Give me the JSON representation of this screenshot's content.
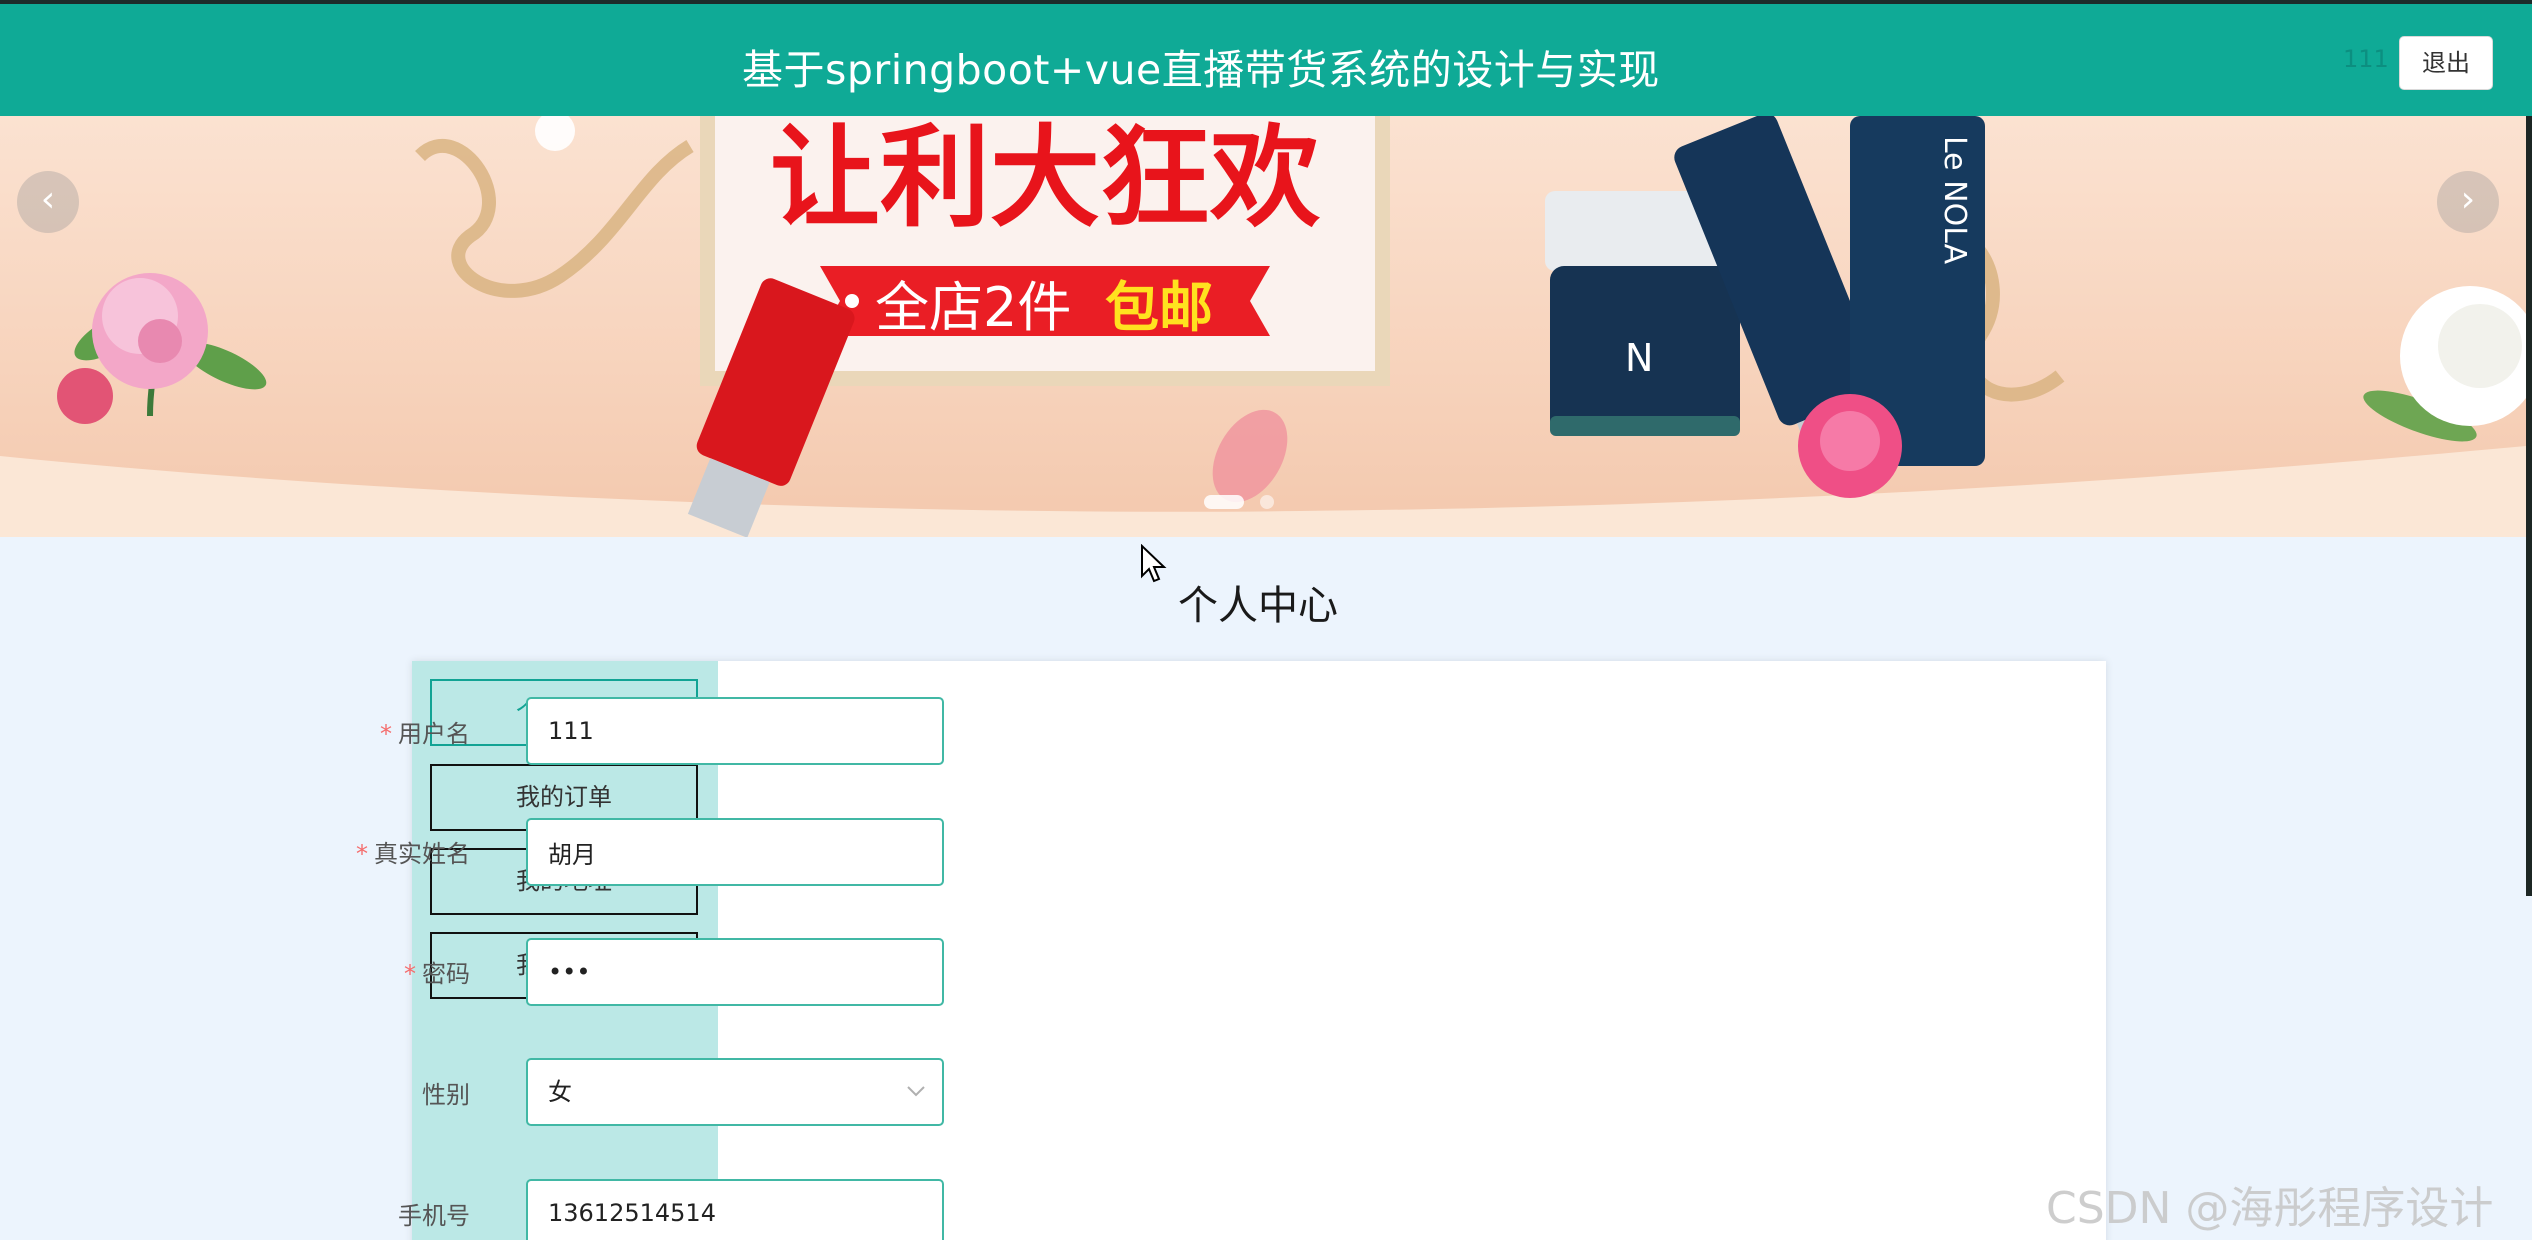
{
  "header": {
    "title": "基于springboot+vue直播带货系统的设计与实现",
    "username": "111",
    "logout_label": "退出",
    "background_color": "#0faa96"
  },
  "banner": {
    "headline": "让利大狂欢",
    "subline_white": "全店2件",
    "subline_yellow": "包邮",
    "brand_text": "Le NOLA",
    "prev_icon": "chevron-left-icon",
    "next_icon": "chevron-right-icon",
    "prev_glyph": "‹",
    "next_glyph": "›"
  },
  "section_title": "个人中心",
  "side_menu": {
    "items": [
      {
        "label": "个人中心",
        "active": true
      },
      {
        "label": "我的订单",
        "active": false
      },
      {
        "label": "我的地址",
        "active": false
      },
      {
        "label": "我的收藏",
        "active": false
      }
    ]
  },
  "form": {
    "required_mark": "*",
    "username": {
      "label": "用户名",
      "value": "111",
      "required": true
    },
    "realname": {
      "label": "真实姓名",
      "value": "胡月",
      "required": true
    },
    "password": {
      "label": "密码",
      "value": "111",
      "required": true
    },
    "gender": {
      "label": "性别",
      "value": "女",
      "icon": "chevron-down-icon"
    },
    "phone": {
      "label": "手机号",
      "value": "13612514514"
    }
  },
  "watermark": "CSDN @海彤程序设计",
  "colors": {
    "accent": "#12a394",
    "menu_background": "#bbe8e6",
    "page_background": "#ecf4fd",
    "required": "#f56c6c"
  }
}
